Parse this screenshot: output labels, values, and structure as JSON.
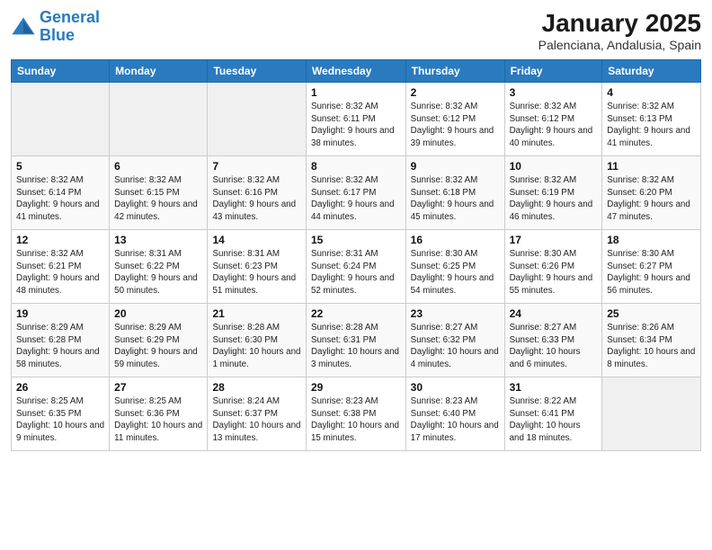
{
  "logo": {
    "line1": "General",
    "line2": "Blue"
  },
  "title": "January 2025",
  "location": "Palenciana, Andalusia, Spain",
  "days_of_week": [
    "Sunday",
    "Monday",
    "Tuesday",
    "Wednesday",
    "Thursday",
    "Friday",
    "Saturday"
  ],
  "weeks": [
    [
      {
        "day": "",
        "info": ""
      },
      {
        "day": "",
        "info": ""
      },
      {
        "day": "",
        "info": ""
      },
      {
        "day": "1",
        "info": "Sunrise: 8:32 AM\nSunset: 6:11 PM\nDaylight: 9 hours and 38 minutes."
      },
      {
        "day": "2",
        "info": "Sunrise: 8:32 AM\nSunset: 6:12 PM\nDaylight: 9 hours and 39 minutes."
      },
      {
        "day": "3",
        "info": "Sunrise: 8:32 AM\nSunset: 6:12 PM\nDaylight: 9 hours and 40 minutes."
      },
      {
        "day": "4",
        "info": "Sunrise: 8:32 AM\nSunset: 6:13 PM\nDaylight: 9 hours and 41 minutes."
      }
    ],
    [
      {
        "day": "5",
        "info": "Sunrise: 8:32 AM\nSunset: 6:14 PM\nDaylight: 9 hours and 41 minutes."
      },
      {
        "day": "6",
        "info": "Sunrise: 8:32 AM\nSunset: 6:15 PM\nDaylight: 9 hours and 42 minutes."
      },
      {
        "day": "7",
        "info": "Sunrise: 8:32 AM\nSunset: 6:16 PM\nDaylight: 9 hours and 43 minutes."
      },
      {
        "day": "8",
        "info": "Sunrise: 8:32 AM\nSunset: 6:17 PM\nDaylight: 9 hours and 44 minutes."
      },
      {
        "day": "9",
        "info": "Sunrise: 8:32 AM\nSunset: 6:18 PM\nDaylight: 9 hours and 45 minutes."
      },
      {
        "day": "10",
        "info": "Sunrise: 8:32 AM\nSunset: 6:19 PM\nDaylight: 9 hours and 46 minutes."
      },
      {
        "day": "11",
        "info": "Sunrise: 8:32 AM\nSunset: 6:20 PM\nDaylight: 9 hours and 47 minutes."
      }
    ],
    [
      {
        "day": "12",
        "info": "Sunrise: 8:32 AM\nSunset: 6:21 PM\nDaylight: 9 hours and 48 minutes."
      },
      {
        "day": "13",
        "info": "Sunrise: 8:31 AM\nSunset: 6:22 PM\nDaylight: 9 hours and 50 minutes."
      },
      {
        "day": "14",
        "info": "Sunrise: 8:31 AM\nSunset: 6:23 PM\nDaylight: 9 hours and 51 minutes."
      },
      {
        "day": "15",
        "info": "Sunrise: 8:31 AM\nSunset: 6:24 PM\nDaylight: 9 hours and 52 minutes."
      },
      {
        "day": "16",
        "info": "Sunrise: 8:30 AM\nSunset: 6:25 PM\nDaylight: 9 hours and 54 minutes."
      },
      {
        "day": "17",
        "info": "Sunrise: 8:30 AM\nSunset: 6:26 PM\nDaylight: 9 hours and 55 minutes."
      },
      {
        "day": "18",
        "info": "Sunrise: 8:30 AM\nSunset: 6:27 PM\nDaylight: 9 hours and 56 minutes."
      }
    ],
    [
      {
        "day": "19",
        "info": "Sunrise: 8:29 AM\nSunset: 6:28 PM\nDaylight: 9 hours and 58 minutes."
      },
      {
        "day": "20",
        "info": "Sunrise: 8:29 AM\nSunset: 6:29 PM\nDaylight: 9 hours and 59 minutes."
      },
      {
        "day": "21",
        "info": "Sunrise: 8:28 AM\nSunset: 6:30 PM\nDaylight: 10 hours and 1 minute."
      },
      {
        "day": "22",
        "info": "Sunrise: 8:28 AM\nSunset: 6:31 PM\nDaylight: 10 hours and 3 minutes."
      },
      {
        "day": "23",
        "info": "Sunrise: 8:27 AM\nSunset: 6:32 PM\nDaylight: 10 hours and 4 minutes."
      },
      {
        "day": "24",
        "info": "Sunrise: 8:27 AM\nSunset: 6:33 PM\nDaylight: 10 hours and 6 minutes."
      },
      {
        "day": "25",
        "info": "Sunrise: 8:26 AM\nSunset: 6:34 PM\nDaylight: 10 hours and 8 minutes."
      }
    ],
    [
      {
        "day": "26",
        "info": "Sunrise: 8:25 AM\nSunset: 6:35 PM\nDaylight: 10 hours and 9 minutes."
      },
      {
        "day": "27",
        "info": "Sunrise: 8:25 AM\nSunset: 6:36 PM\nDaylight: 10 hours and 11 minutes."
      },
      {
        "day": "28",
        "info": "Sunrise: 8:24 AM\nSunset: 6:37 PM\nDaylight: 10 hours and 13 minutes."
      },
      {
        "day": "29",
        "info": "Sunrise: 8:23 AM\nSunset: 6:38 PM\nDaylight: 10 hours and 15 minutes."
      },
      {
        "day": "30",
        "info": "Sunrise: 8:23 AM\nSunset: 6:40 PM\nDaylight: 10 hours and 17 minutes."
      },
      {
        "day": "31",
        "info": "Sunrise: 8:22 AM\nSunset: 6:41 PM\nDaylight: 10 hours and 18 minutes."
      },
      {
        "day": "",
        "info": ""
      }
    ]
  ]
}
